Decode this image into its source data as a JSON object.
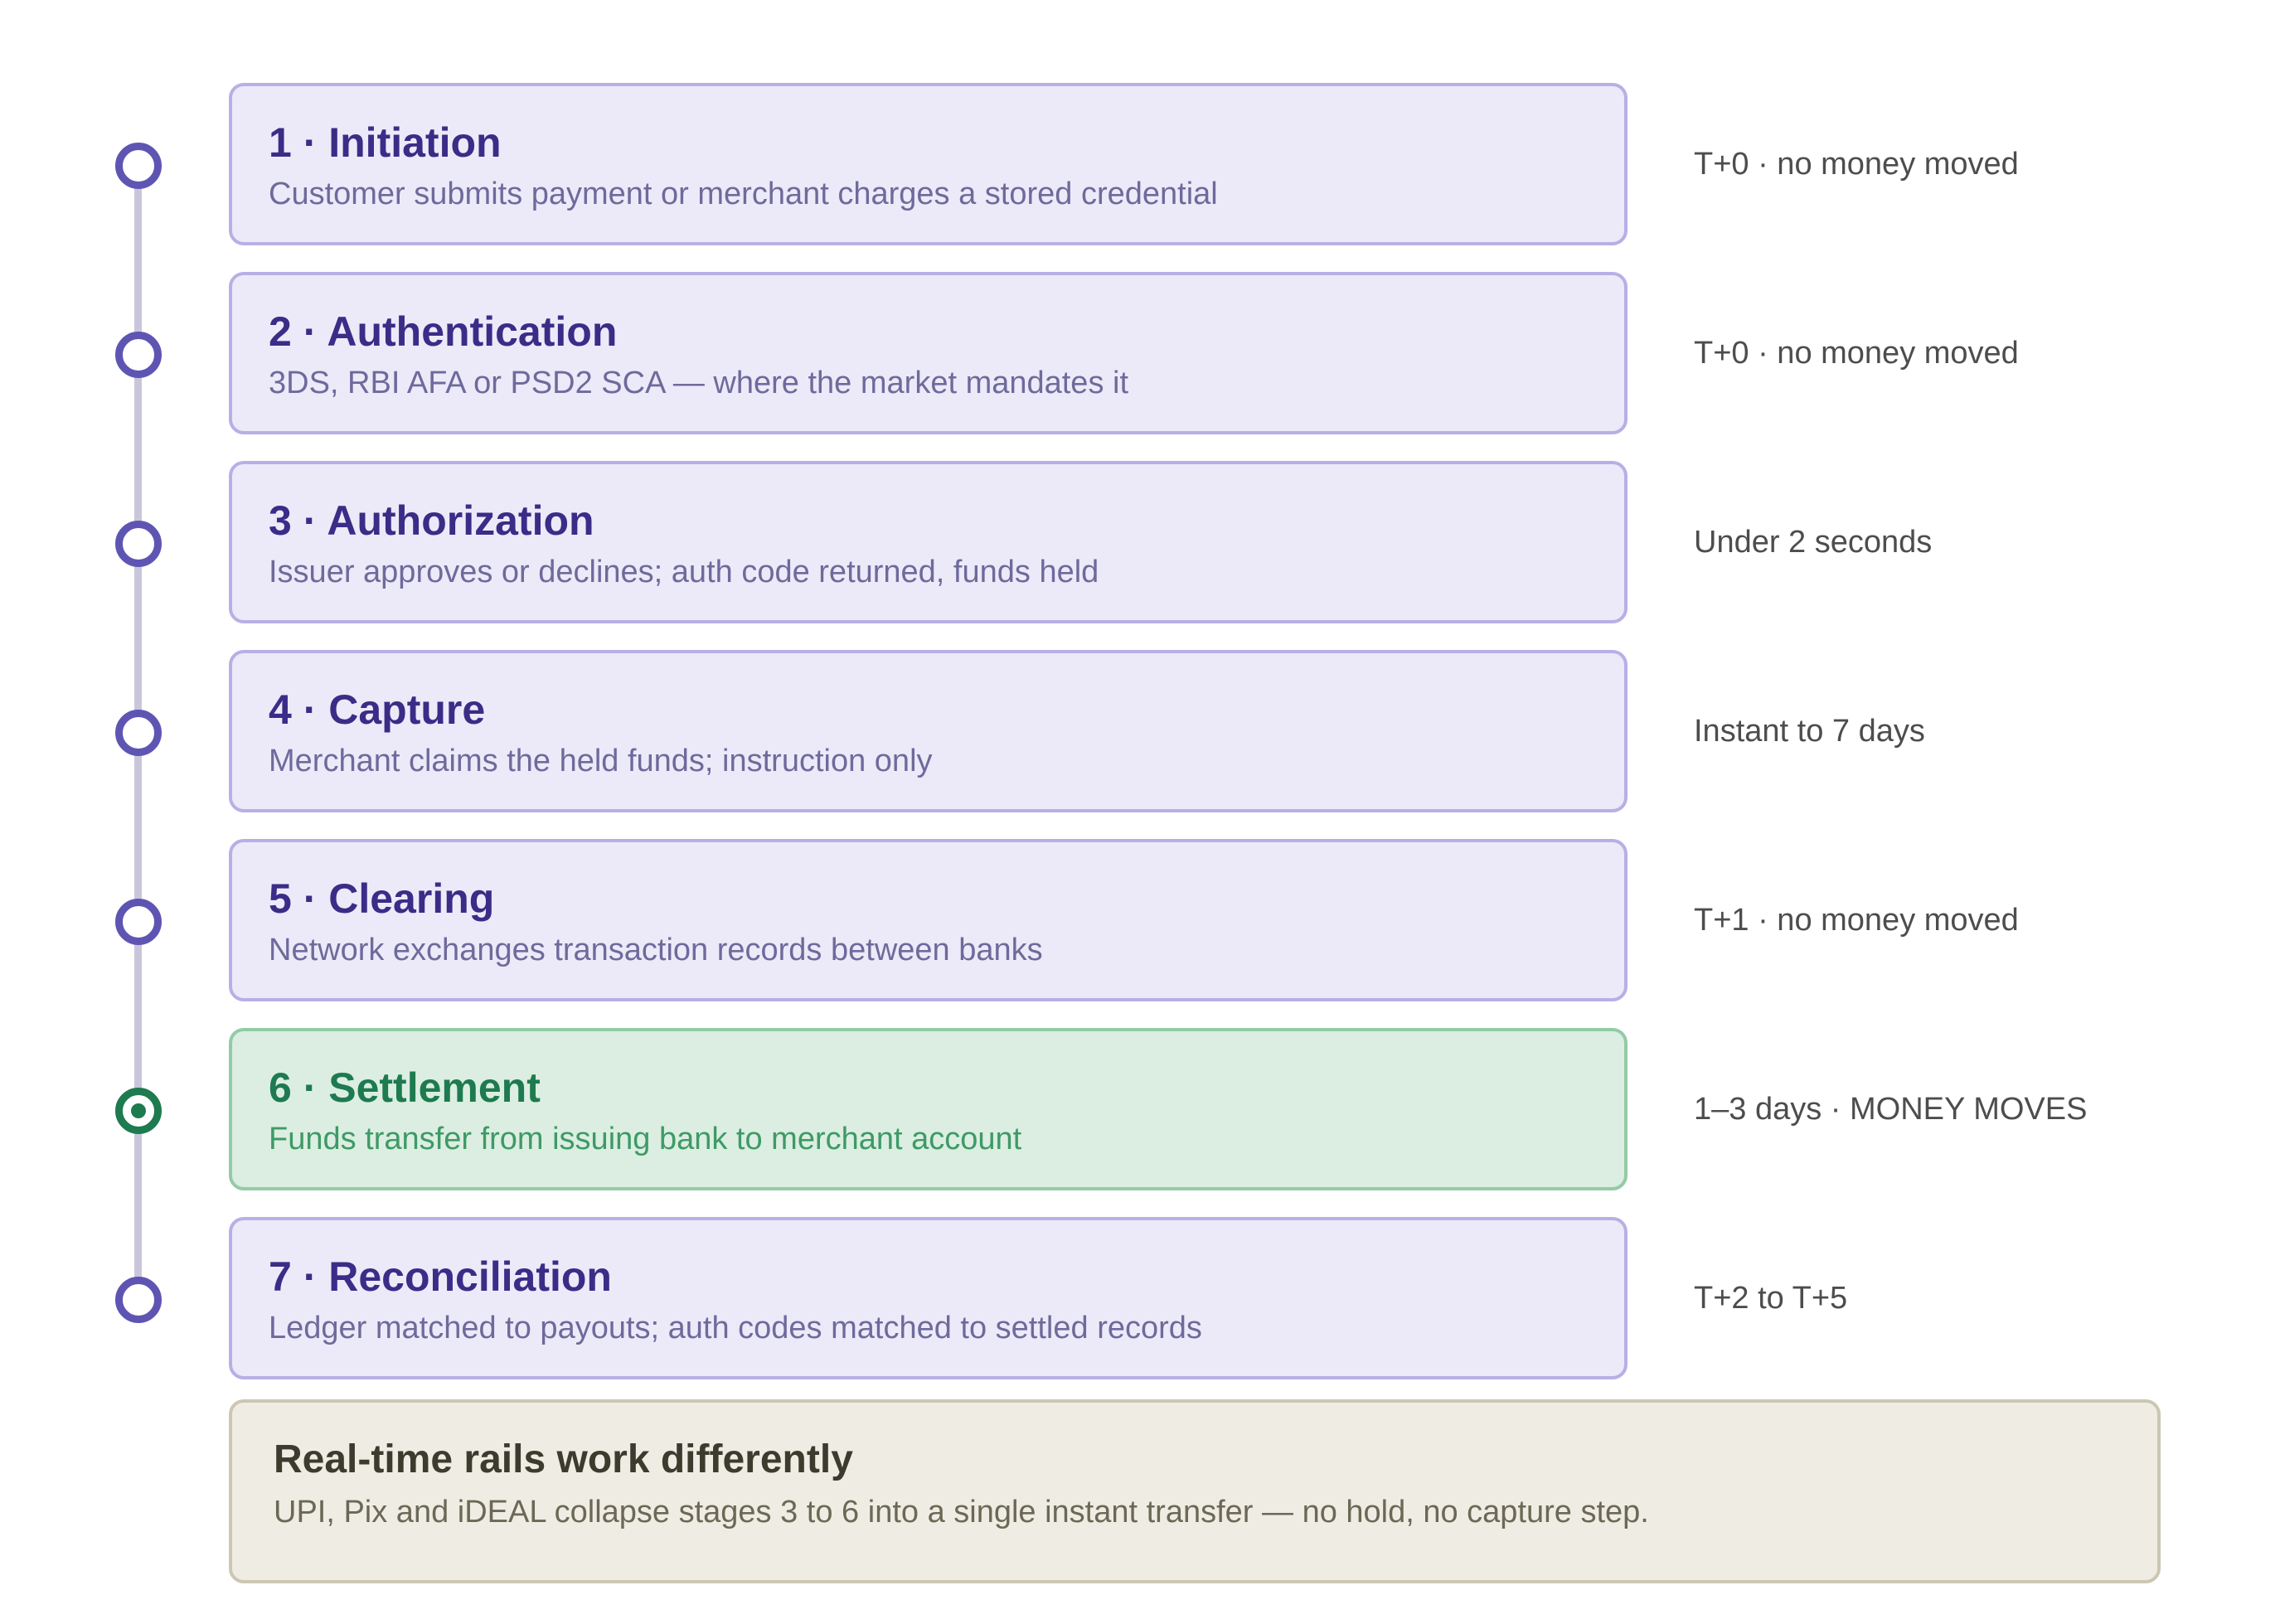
{
  "colors": {
    "accent": "#5e55b3",
    "stage_fill": "#eceaf8",
    "stage_border": "#b7b0e6",
    "stage_title": "#3a2c87",
    "highlight": "#1e7a4f",
    "highlight_fill": "#dbeee1",
    "note_fill": "#efede3"
  },
  "stages": [
    {
      "title": "1 · Initiation",
      "description": "Customer submits payment or merchant charges a stored credential",
      "timing": "T+0 · no money moved"
    },
    {
      "title": "2 · Authentication",
      "description": "3DS, RBI AFA or PSD2 SCA — where the market mandates it",
      "timing": "T+0 · no money moved"
    },
    {
      "title": "3 · Authorization",
      "description": "Issuer approves or declines; auth code returned, funds held",
      "timing": "Under 2 seconds"
    },
    {
      "title": "4 · Capture",
      "description": "Merchant claims the held funds; instruction only",
      "timing": "Instant to 7 days"
    },
    {
      "title": "5 · Clearing",
      "description": "Network exchanges transaction records between banks",
      "timing": "T+1 · no money moved"
    },
    {
      "title": "6 · Settlement",
      "description": "Funds transfer from issuing bank to merchant account",
      "timing": "1–3 days · MONEY MOVES"
    },
    {
      "title": "7 · Reconciliation",
      "description": "Ledger matched to payouts; auth codes matched to settled records",
      "timing": "T+2 to T+5"
    }
  ],
  "note": {
    "title": "Real-time rails work differently",
    "description": "UPI, Pix and iDEAL collapse stages 3 to 6 into a single instant transfer — no hold, no capture step."
  }
}
